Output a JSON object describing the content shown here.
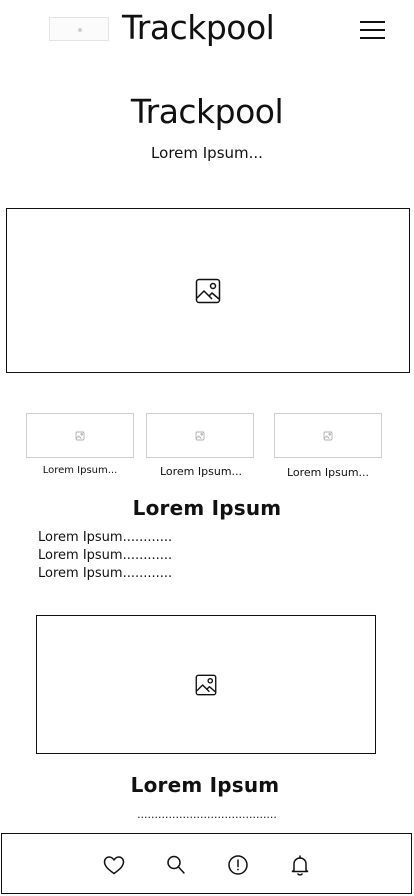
{
  "header": {
    "brand": "Trackpool",
    "logo_icon": "logo-placeholder",
    "menu_icon": "hamburger-menu-icon"
  },
  "hero": {
    "title": "Trackpool",
    "subtitle": "Lorem Ipsum..."
  },
  "banner": {
    "icon": "image-icon"
  },
  "thumbnails": [
    {
      "caption": "Lorem Ipsum...",
      "icon": "image-icon"
    },
    {
      "caption": "Lorem Ipsum...",
      "icon": "image-icon"
    },
    {
      "caption": "Lorem Ipsum...",
      "icon": "image-icon"
    }
  ],
  "section1": {
    "title": "Lorem Ipsum",
    "items": [
      "Lorem Ipsum............",
      "Lorem Ipsum............",
      "Lorem Ipsum............"
    ]
  },
  "feature": {
    "icon": "image-icon"
  },
  "section2": {
    "title": "Lorem Ipsum",
    "text": "........................................"
  },
  "bottom_nav": [
    {
      "icon": "heart-icon"
    },
    {
      "icon": "search-icon"
    },
    {
      "icon": "alert-icon"
    },
    {
      "icon": "bell-icon"
    }
  ]
}
